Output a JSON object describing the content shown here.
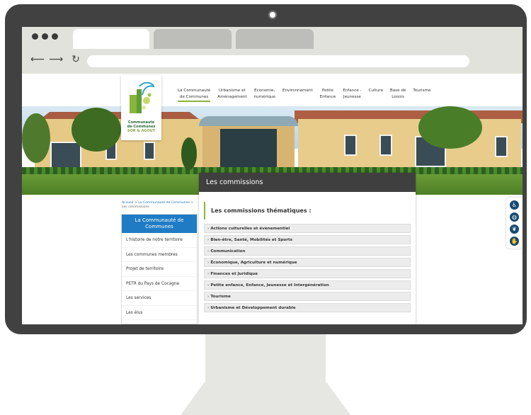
{
  "site": {
    "logo": {
      "line1": "Communauté",
      "line2": "de Communes",
      "line3": "SOR & AGOUT"
    },
    "main_nav": [
      {
        "line1": "La Communauté",
        "line2": "de Communes",
        "active": true
      },
      {
        "line1": "Urbanisme et",
        "line2": "Aménagement",
        "active": false
      },
      {
        "line1": "Economie,",
        "line2": "numérique",
        "active": false
      },
      {
        "line1": "Environnement",
        "line2": "",
        "active": false
      },
      {
        "line1": "Petite",
        "line2": "Enfance",
        "active": false
      },
      {
        "line1": "Enfance -",
        "line2": "Jeunesse",
        "active": false
      },
      {
        "line1": "Culture",
        "line2": "",
        "active": false
      },
      {
        "line1": "Base de",
        "line2": "Loisirs",
        "active": false
      },
      {
        "line1": "Tourisme",
        "line2": "",
        "active": false
      }
    ],
    "breadcrumb": {
      "home": "Accueil",
      "sep": ">",
      "parent": "La Communauté de Communes",
      "current": "Les commissions"
    },
    "sidebar": {
      "title": "La Communauté de Communes",
      "items": [
        "L'histoire de notre territoire",
        "Les communes membres",
        "Projet de territoire",
        "PETR du Pays de Cocagne",
        "Les services",
        "Les élus"
      ]
    },
    "content": {
      "header": "Les commissions",
      "section_title": "Les commissions thématiques :",
      "accordion_items": [
        "Actions culturelles et évènementiel",
        "Bien-être, Santé, Mobilités et Sports",
        "Communication",
        "Économique, Agriculture et numérique",
        "Finances et Juridique",
        "Petite enfance, Enfance, Jeunesse et Intergénération",
        "Tourisme",
        "Urbanisme et Développement durable"
      ],
      "chevron": "›"
    },
    "widgets": [
      {
        "icon": "accessibility-icon",
        "glyph": "♿"
      },
      {
        "icon": "globe-icon",
        "glyph": "◍"
      },
      {
        "icon": "leaf-icon",
        "glyph": "❦"
      },
      {
        "icon": "sign-language-icon",
        "glyph": "✋"
      }
    ]
  },
  "browser": {
    "nav_back": "⟵",
    "nav_forward": "⟶",
    "nav_reload": "↻"
  },
  "colors": {
    "accent_green": "#8bb53a",
    "accent_blue": "#1f7cc4",
    "header_dark": "#3f3f3f",
    "monitor_frame": "#414141"
  }
}
